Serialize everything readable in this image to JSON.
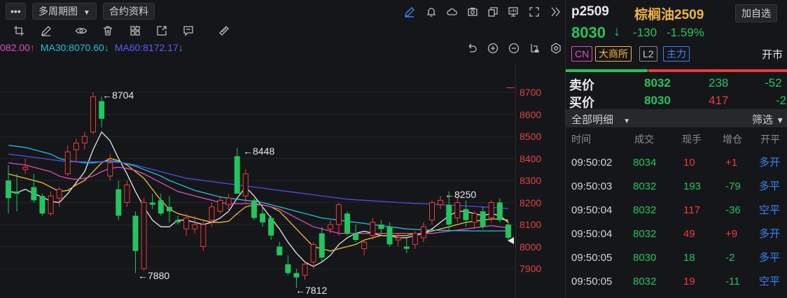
{
  "toolbar": {
    "more_label": "•••",
    "multi_period_label": "多周期图",
    "contract_info_label": "合约资料",
    "icons": [
      "pen-icon",
      "bell-icon",
      "cloud-icon",
      "camera-icon",
      "copy-icon",
      "monitor-icon",
      "fullscreen-icon",
      "chevrons-right-icon"
    ]
  },
  "drawing_tools": [
    "crop-icon",
    "pencil-icon",
    "eye-icon",
    "trash-icon",
    "layers-icon",
    "share-icon",
    "comment-icon",
    "ruler-icon"
  ],
  "chart_controls": [
    "undo-icon",
    "zoom-in-icon",
    "zoom-out-icon",
    "crop-chart-icon",
    "settings-icon"
  ],
  "ma_legend": {
    "ma_partial": "082.00",
    "ma_partial_arrow": "↑",
    "ma30": "MA30:8070.60",
    "ma30_arrow": "↓",
    "ma60": "MA60:8172.17",
    "ma60_arrow": "↓"
  },
  "colors": {
    "up": "#ee3b3b",
    "down": "#22c55e",
    "ma5": "#e8e8e8",
    "ma10": "#f2c230",
    "ma20": "#e04ec0",
    "ma30": "#22c1d6",
    "ma60": "#4d4de8"
  },
  "annotations": {
    "high1": "←8704",
    "low1": "←7880",
    "high2": "←8448",
    "low2": "←7812",
    "high3": "←8250"
  },
  "chart_data": {
    "type": "candlestick",
    "ylim": [
      7820,
      8800
    ],
    "yticks": [
      "8700",
      "8600",
      "8500",
      "8400",
      "8300",
      "8200",
      "8100",
      "8000",
      "7900"
    ],
    "candles": [
      {
        "o": 8300,
        "h": 8370,
        "l": 8150,
        "c": 8220
      },
      {
        "o": 8250,
        "h": 8330,
        "l": 8160,
        "c": 8240
      },
      {
        "o": 8350,
        "h": 8400,
        "l": 8330,
        "c": 8360
      },
      {
        "o": 8270,
        "h": 8330,
        "l": 8200,
        "c": 8210
      },
      {
        "o": 8230,
        "h": 8240,
        "l": 8140,
        "c": 8150
      },
      {
        "o": 8150,
        "h": 8250,
        "l": 8140,
        "c": 8230
      },
      {
        "o": 8220,
        "h": 8270,
        "l": 8180,
        "c": 8260
      },
      {
        "o": 8330,
        "h": 8460,
        "l": 8320,
        "c": 8430
      },
      {
        "o": 8440,
        "h": 8490,
        "l": 8380,
        "c": 8470
      },
      {
        "o": 8470,
        "h": 8520,
        "l": 8440,
        "c": 8500
      },
      {
        "o": 8520,
        "h": 8700,
        "l": 8510,
        "c": 8680
      },
      {
        "o": 8660,
        "h": 8680,
        "l": 8540,
        "c": 8580
      },
      {
        "o": 8320,
        "h": 8420,
        "l": 8300,
        "c": 8380
      },
      {
        "o": 8260,
        "h": 8300,
        "l": 8120,
        "c": 8140
      },
      {
        "o": 8200,
        "h": 8300,
        "l": 8180,
        "c": 8280
      },
      {
        "o": 8140,
        "h": 8160,
        "l": 7880,
        "c": 7980
      },
      {
        "o": 7900,
        "h": 8220,
        "l": 7890,
        "c": 8200
      },
      {
        "o": 8200,
        "h": 8240,
        "l": 8170,
        "c": 8190
      },
      {
        "o": 8210,
        "h": 8240,
        "l": 8140,
        "c": 8150
      },
      {
        "o": 8180,
        "h": 8230,
        "l": 8110,
        "c": 8160
      },
      {
        "o": 8120,
        "h": 8140,
        "l": 8100,
        "c": 8110
      },
      {
        "o": 8080,
        "h": 8150,
        "l": 8050,
        "c": 8130
      },
      {
        "o": 8080,
        "h": 8140,
        "l": 8060,
        "c": 8100
      },
      {
        "o": 8000,
        "h": 8120,
        "l": 7980,
        "c": 8100
      },
      {
        "o": 8120,
        "h": 8200,
        "l": 8090,
        "c": 8180
      },
      {
        "o": 8160,
        "h": 8230,
        "l": 8150,
        "c": 8210
      },
      {
        "o": 8190,
        "h": 8240,
        "l": 8160,
        "c": 8220
      },
      {
        "o": 8410,
        "h": 8448,
        "l": 8240,
        "c": 8240
      },
      {
        "o": 8230,
        "h": 8350,
        "l": 8200,
        "c": 8330
      },
      {
        "o": 8210,
        "h": 8220,
        "l": 8120,
        "c": 8130
      },
      {
        "o": 8150,
        "h": 8180,
        "l": 8090,
        "c": 8110
      },
      {
        "o": 8130,
        "h": 8140,
        "l": 8030,
        "c": 8050
      },
      {
        "o": 8000,
        "h": 8020,
        "l": 7960,
        "c": 7960
      },
      {
        "o": 7920,
        "h": 7960,
        "l": 7870,
        "c": 7880
      },
      {
        "o": 7880,
        "h": 7900,
        "l": 7812,
        "c": 7860
      },
      {
        "o": 7870,
        "h": 7930,
        "l": 7850,
        "c": 7920
      },
      {
        "o": 7930,
        "h": 8020,
        "l": 7900,
        "c": 8010
      },
      {
        "o": 8060,
        "h": 8090,
        "l": 7930,
        "c": 7950
      },
      {
        "o": 8080,
        "h": 8120,
        "l": 8060,
        "c": 8100
      },
      {
        "o": 8100,
        "h": 8200,
        "l": 8050,
        "c": 8190
      },
      {
        "o": 8150,
        "h": 8160,
        "l": 8050,
        "c": 8060
      },
      {
        "o": 8060,
        "h": 8100,
        "l": 8020,
        "c": 8030
      },
      {
        "o": 7990,
        "h": 8030,
        "l": 7960,
        "c": 8020
      },
      {
        "o": 8050,
        "h": 8130,
        "l": 8030,
        "c": 8110
      },
      {
        "o": 8100,
        "h": 8120,
        "l": 8050,
        "c": 8080
      },
      {
        "o": 8090,
        "h": 8110,
        "l": 8000,
        "c": 8010
      },
      {
        "o": 8030,
        "h": 8060,
        "l": 8000,
        "c": 8040
      },
      {
        "o": 8000,
        "h": 8040,
        "l": 7970,
        "c": 7990
      },
      {
        "o": 8010,
        "h": 8070,
        "l": 7990,
        "c": 8060
      },
      {
        "o": 8040,
        "h": 8110,
        "l": 8020,
        "c": 8090
      },
      {
        "o": 8120,
        "h": 8210,
        "l": 8100,
        "c": 8200
      },
      {
        "o": 8190,
        "h": 8230,
        "l": 8170,
        "c": 8210
      },
      {
        "o": 8190,
        "h": 8250,
        "l": 8070,
        "c": 8100
      },
      {
        "o": 8130,
        "h": 8230,
        "l": 8110,
        "c": 8200
      },
      {
        "o": 8170,
        "h": 8210,
        "l": 8090,
        "c": 8120
      },
      {
        "o": 8110,
        "h": 8160,
        "l": 8080,
        "c": 8150
      },
      {
        "o": 8160,
        "h": 8180,
        "l": 8080,
        "c": 8090
      },
      {
        "o": 8130,
        "h": 8210,
        "l": 8110,
        "c": 8200
      },
      {
        "o": 8200,
        "h": 8220,
        "l": 8110,
        "c": 8120
      },
      {
        "o": 8100,
        "h": 8110,
        "l": 8030,
        "c": 8040
      }
    ],
    "ma_lines": {
      "ma5": [
        8250,
        8245,
        8260,
        8240,
        8225,
        8205,
        8200,
        8240,
        8290,
        8340,
        8440,
        8520,
        8480,
        8400,
        8330,
        8250,
        8180,
        8120,
        8090,
        8090,
        8120,
        8120,
        8110,
        8100,
        8110,
        8130,
        8160,
        8220,
        8270,
        8230,
        8180,
        8130,
        8080,
        8020,
        7970,
        7930,
        7910,
        7930,
        7960,
        8010,
        8040,
        8060,
        8070,
        8060,
        8050,
        8050,
        8040,
        8040,
        8050,
        8060,
        8080,
        8110,
        8140,
        8160,
        8160,
        8150,
        8140,
        8150,
        8140,
        8110
      ],
      "ma10": [
        8330,
        8320,
        8310,
        8300,
        8290,
        8270,
        8250,
        8255,
        8280,
        8300,
        8340,
        8380,
        8400,
        8390,
        8370,
        8340,
        8310,
        8260,
        8210,
        8170,
        8150,
        8140,
        8130,
        8120,
        8110,
        8110,
        8115,
        8150,
        8180,
        8190,
        8190,
        8180,
        8160,
        8120,
        8080,
        8040,
        8000,
        7990,
        7980,
        7990,
        8000,
        8010,
        8030,
        8040,
        8050,
        8050,
        8050,
        8050,
        8060,
        8060,
        8070,
        8080,
        8090,
        8100,
        8110,
        8115,
        8120,
        8125,
        8125,
        8120
      ],
      "ma20": [
        8380,
        8375,
        8370,
        8360,
        8350,
        8340,
        8320,
        8310,
        8305,
        8310,
        8320,
        8340,
        8355,
        8360,
        8355,
        8345,
        8330,
        8310,
        8290,
        8270,
        8250,
        8240,
        8230,
        8220,
        8210,
        8200,
        8195,
        8195,
        8195,
        8195,
        8190,
        8180,
        8170,
        8150,
        8130,
        8110,
        8090,
        8080,
        8070,
        8060,
        8060,
        8060,
        8060,
        8060,
        8060,
        8060,
        8060,
        8060,
        8060,
        8060,
        8060,
        8065,
        8070,
        8075,
        8080,
        8085,
        8090,
        8095,
        8090,
        8085
      ],
      "ma30": [
        8460,
        8455,
        8450,
        8440,
        8430,
        8420,
        8400,
        8390,
        8385,
        8380,
        8380,
        8385,
        8390,
        8385,
        8375,
        8365,
        8350,
        8335,
        8320,
        8300,
        8285,
        8270,
        8255,
        8245,
        8235,
        8225,
        8220,
        8215,
        8210,
        8205,
        8200,
        8190,
        8180,
        8170,
        8160,
        8150,
        8140,
        8130,
        8125,
        8120,
        8115,
        8110,
        8105,
        8100,
        8095,
        8090,
        8085,
        8080,
        8078,
        8076,
        8075,
        8074,
        8073,
        8072,
        8072,
        8071,
        8071,
        8071,
        8071,
        8071
      ],
      "ma60": [
        8420,
        8415,
        8410,
        8405,
        8400,
        8395,
        8390,
        8385,
        8385,
        8385,
        8385,
        8385,
        8384,
        8382,
        8378,
        8370,
        8360,
        8350,
        8340,
        8330,
        8320,
        8310,
        8305,
        8300,
        8295,
        8290,
        8285,
        8280,
        8275,
        8270,
        8265,
        8260,
        8255,
        8250,
        8245,
        8240,
        8235,
        8230,
        8225,
        8220,
        8215,
        8212,
        8210,
        8208,
        8205,
        8203,
        8200,
        8198,
        8196,
        8194,
        8192,
        8190,
        8188,
        8186,
        8184,
        8182,
        8180,
        8178,
        8176,
        8172
      ]
    }
  },
  "quote": {
    "code": "p2509",
    "name": "棕榈油2509",
    "add_watch_label": "加自选",
    "price": "8030",
    "price_arrow": "↓",
    "change": "-130",
    "change_pct": "-1.59%",
    "tags": [
      "CN",
      "大商所",
      "L2",
      "主力"
    ],
    "market_status": "开市"
  },
  "depth": {
    "ask_label": "卖价",
    "ask_price": "8032",
    "ask_volume": "238",
    "ask_change": "-52",
    "bid_label": "买价",
    "bid_price": "8030",
    "bid_volume": "417",
    "bid_change": "-2"
  },
  "trades": {
    "filter_label": "全部明细",
    "screen_label": "筛选",
    "headers": [
      "时间",
      "成交",
      "现手",
      "增仓",
      "开平"
    ],
    "rows": [
      {
        "time": "09:50:02",
        "price": "8034",
        "vol": "10",
        "oi": "+1",
        "type": "多开"
      },
      {
        "time": "09:50:03",
        "price": "8032",
        "vol": "193",
        "oi": "-79",
        "type": "多平"
      },
      {
        "time": "09:50:04",
        "price": "8032",
        "vol": "117",
        "oi": "-36",
        "type": "空平"
      },
      {
        "time": "09:50:04",
        "price": "8032",
        "vol": "49",
        "oi": "+9",
        "type": "多开"
      },
      {
        "time": "09:50:05",
        "price": "8030",
        "vol": "18",
        "oi": "-2",
        "type": "多平"
      },
      {
        "time": "09:50:05",
        "price": "8032",
        "vol": "19",
        "oi": "-11",
        "type": "空平"
      }
    ]
  }
}
